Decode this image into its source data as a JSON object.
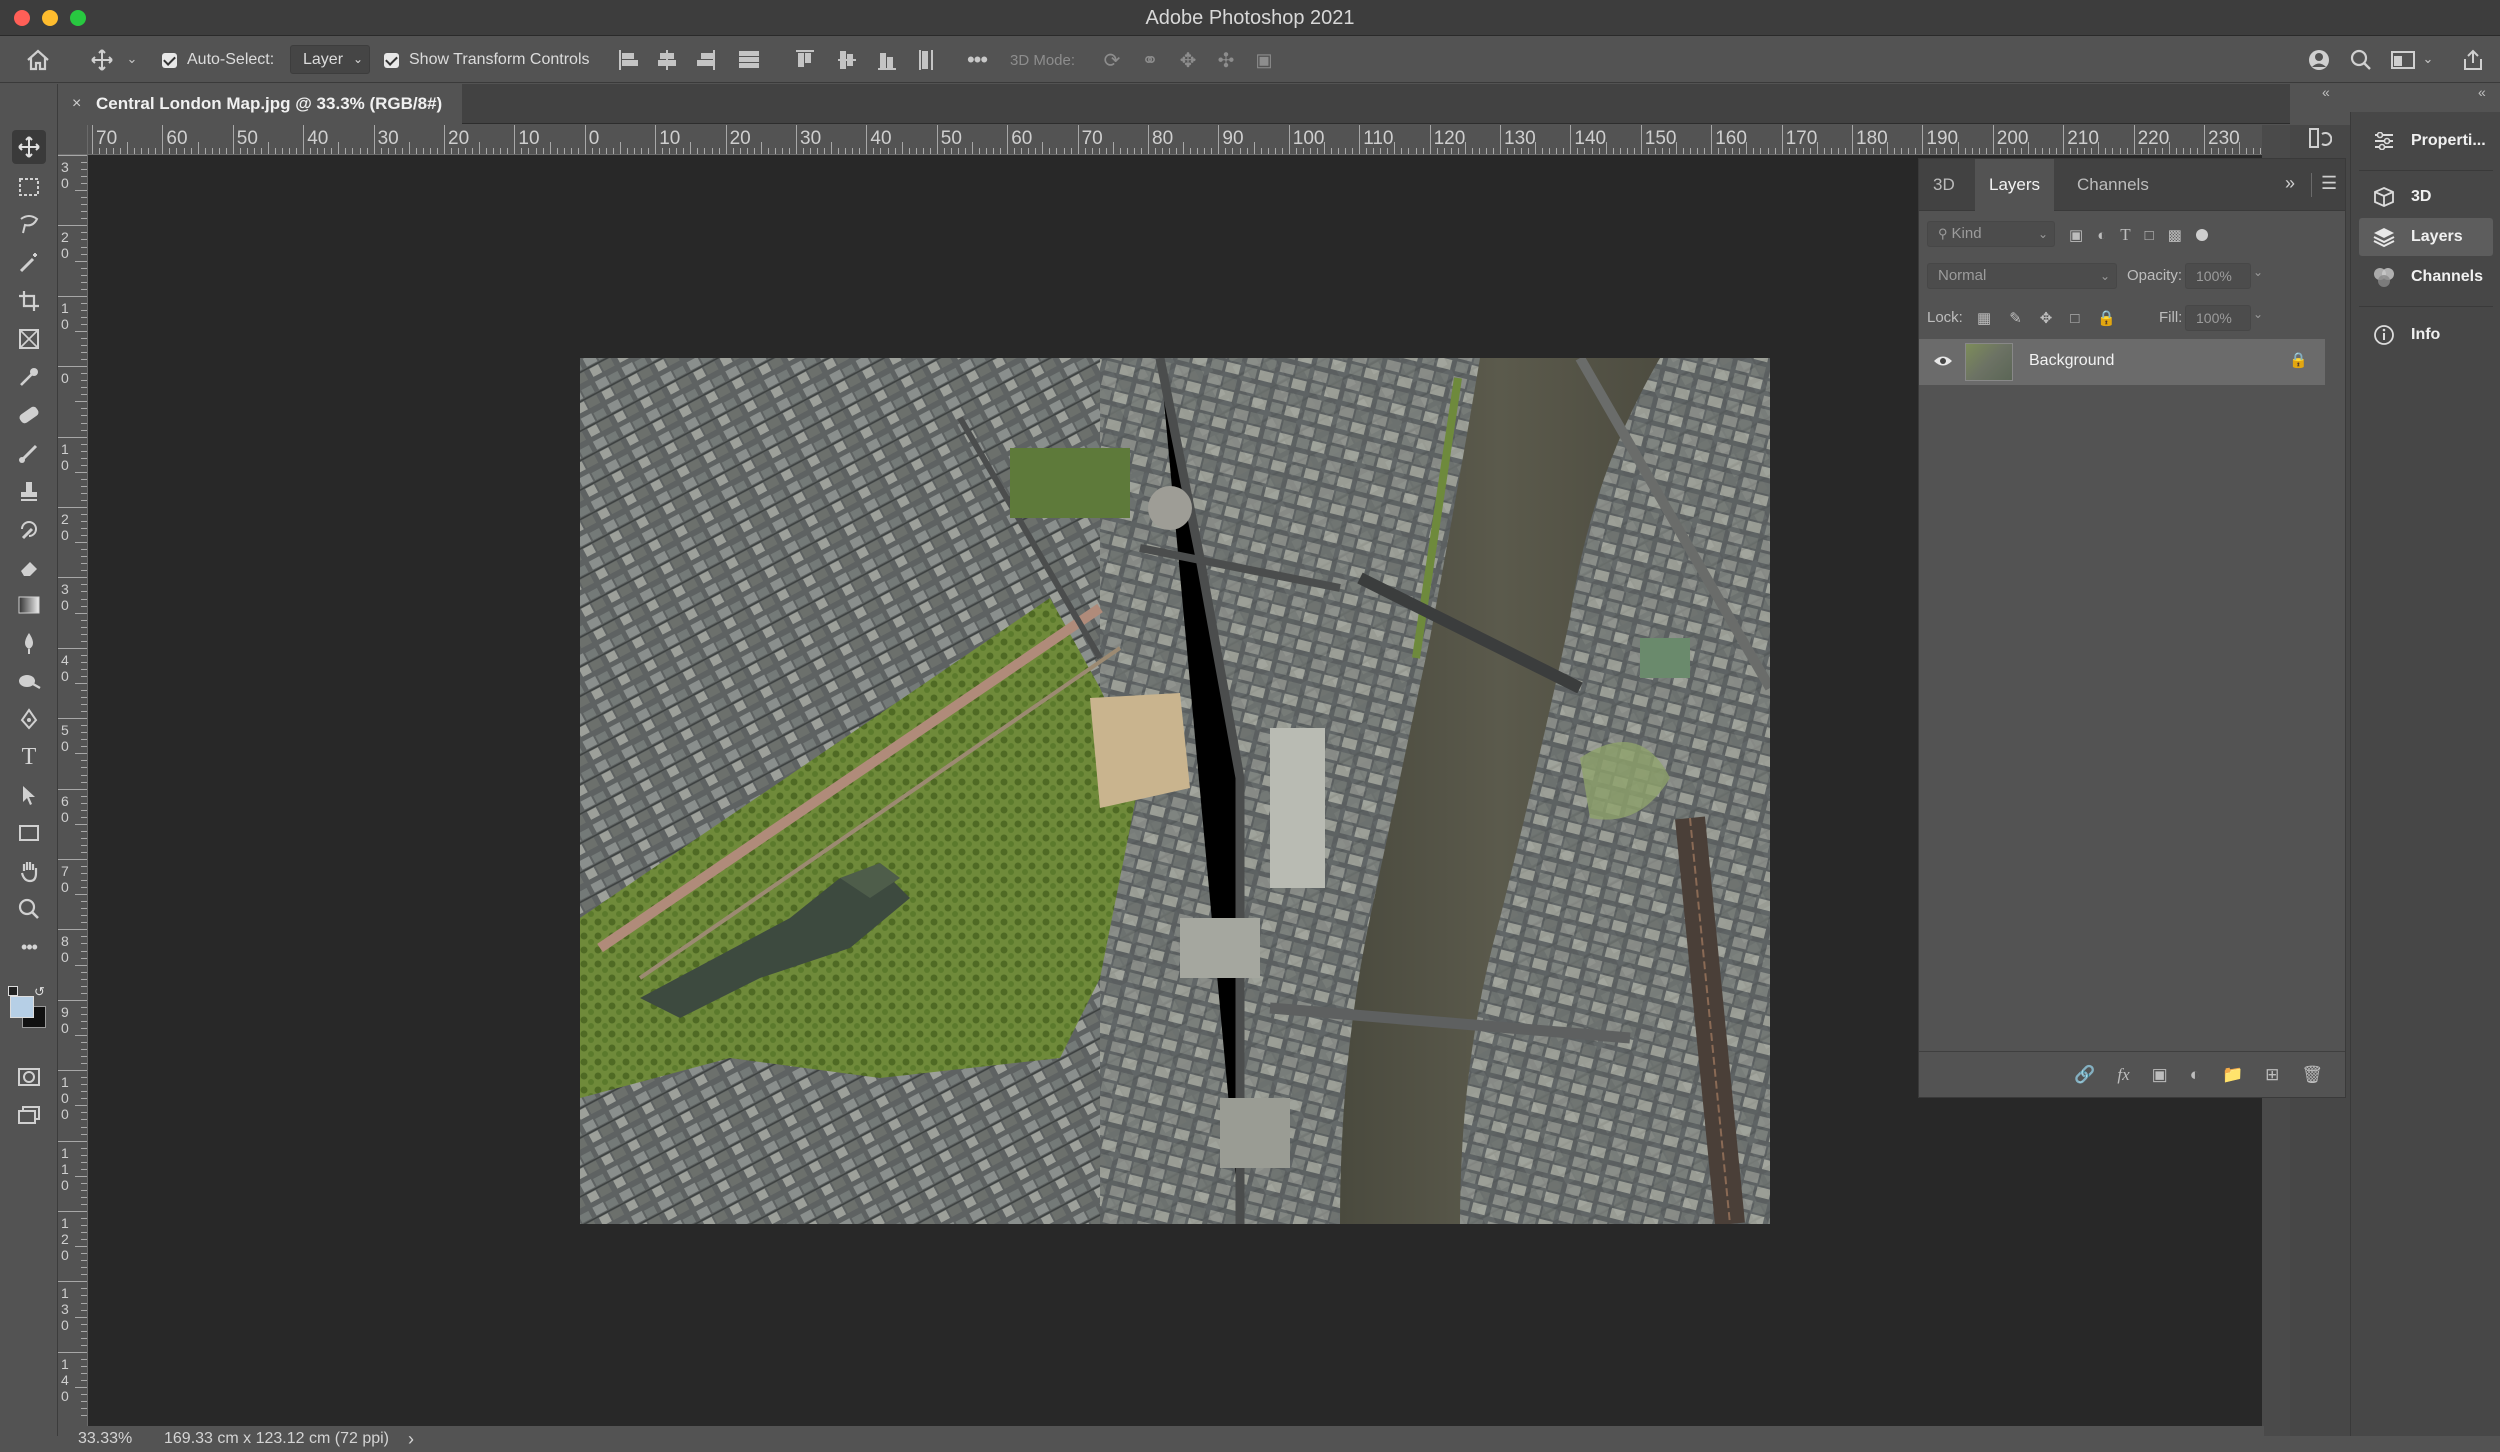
{
  "app": {
    "title": "Adobe Photoshop 2021"
  },
  "options_bar": {
    "auto_select_label": "Auto-Select:",
    "auto_select_value": "Layer",
    "show_transform_label": "Show Transform Controls",
    "mode_3d_label": "3D Mode:"
  },
  "document": {
    "tab_title": "Central London Map.jpg @ 33.3% (RGB/8#)"
  },
  "ruler": {
    "h_labels": [
      "70",
      "60",
      "50",
      "40",
      "30",
      "20",
      "10",
      "0",
      "10",
      "20",
      "30",
      "40",
      "50",
      "60",
      "70",
      "80",
      "90",
      "100",
      "110",
      "120",
      "130",
      "140",
      "150",
      "160",
      "170",
      "180",
      "190",
      "200",
      "210",
      "220",
      "230"
    ],
    "v_labels": [
      "30",
      "20",
      "10",
      "0",
      "10",
      "20",
      "30",
      "40",
      "50",
      "60",
      "70",
      "80",
      "90",
      "100",
      "110",
      "120",
      "130",
      "140"
    ]
  },
  "status": {
    "zoom": "33.33%",
    "doc_size": "169.33 cm x 123.12 cm (72 ppi)"
  },
  "layers_panel": {
    "tabs": [
      "3D",
      "Layers",
      "Channels"
    ],
    "active_tab": "Layers",
    "filter_kind": "Kind",
    "blend_mode": "Normal",
    "opacity_label": "Opacity:",
    "opacity_value": "100%",
    "lock_label": "Lock:",
    "fill_label": "Fill:",
    "fill_value": "100%",
    "layers": [
      {
        "name": "Background",
        "visible": true,
        "locked": true
      }
    ]
  },
  "dock": {
    "items": [
      "Properti...",
      "3D",
      "Layers",
      "Channels",
      "Info"
    ],
    "active": "Layers"
  },
  "colors": {
    "close": "#ff5f57",
    "minimize": "#febc2e",
    "zoom": "#28c840",
    "canvas_bg": "#282828",
    "panel_bg": "#535353"
  }
}
